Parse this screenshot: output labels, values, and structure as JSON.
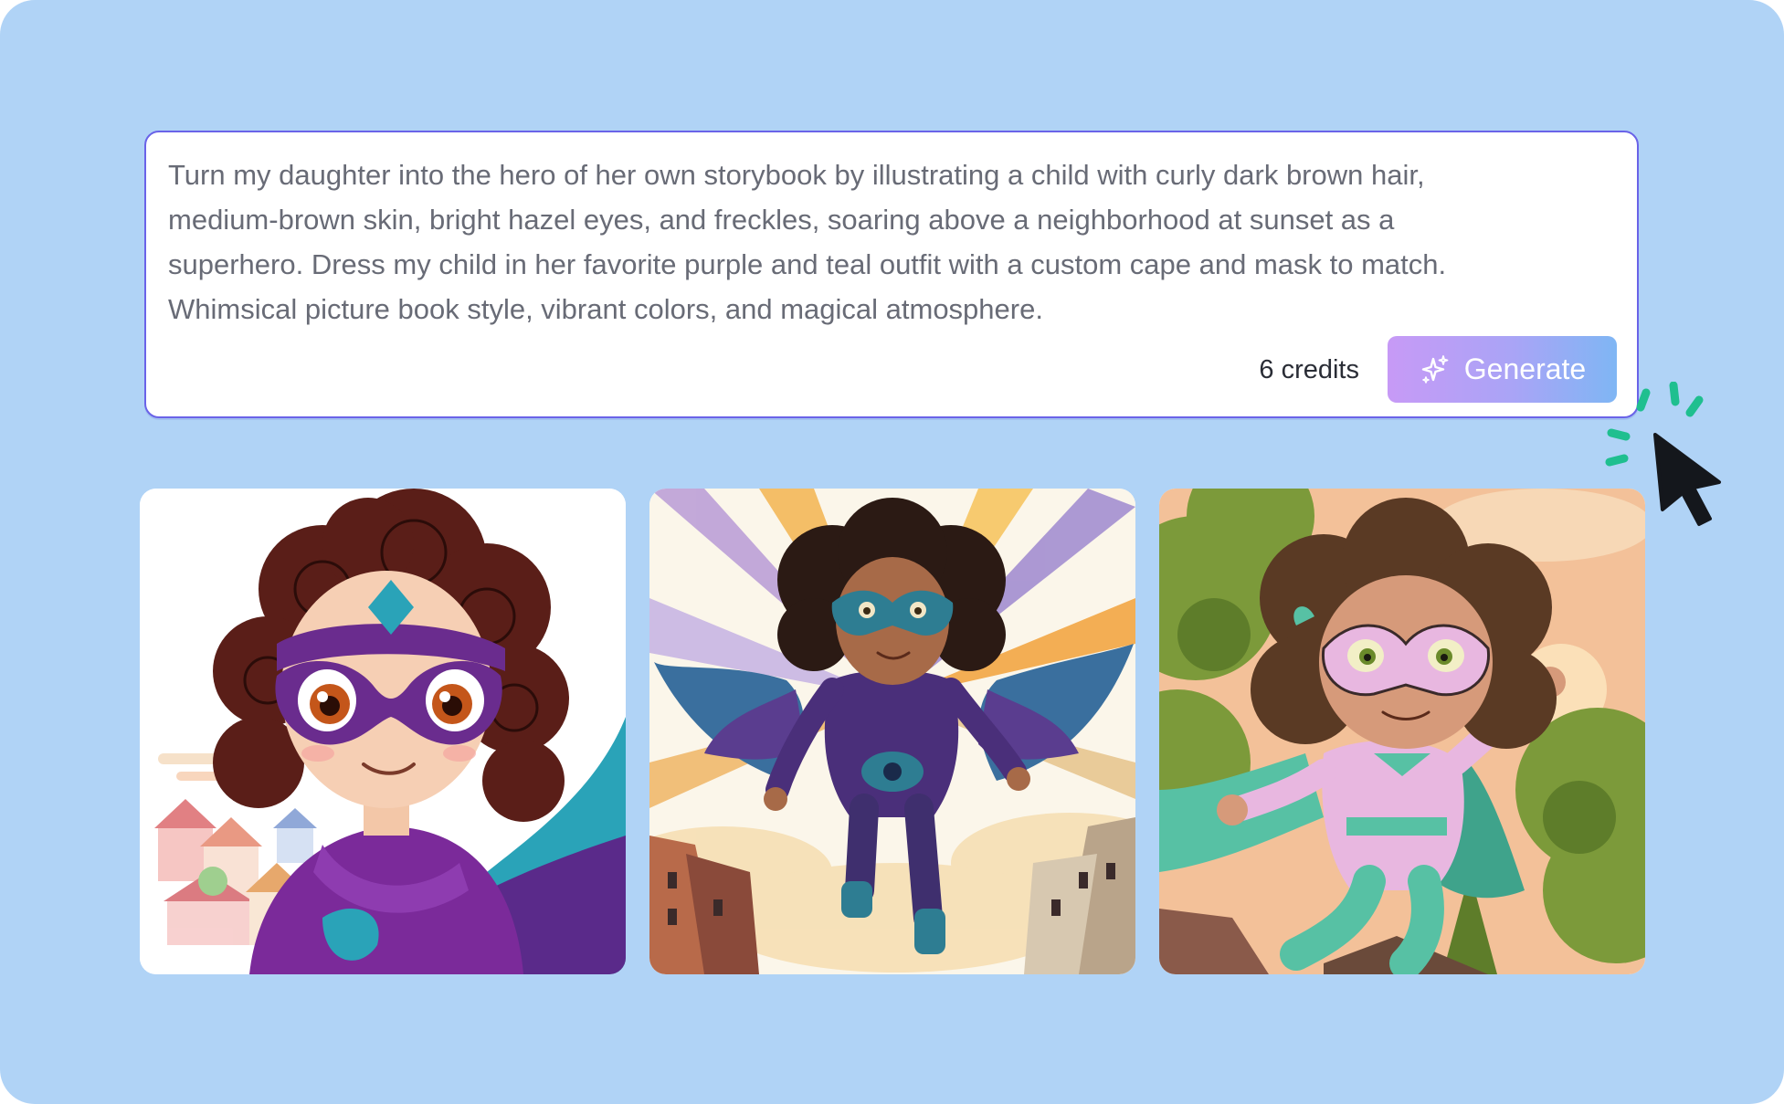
{
  "prompt": {
    "text": "Turn my daughter into the hero of her own storybook by illustrating a child with curly dark brown hair,\nmedium-brown skin, bright hazel eyes, and freckles, soaring above a neighborhood at sunset as a\nsuperhero. Dress my child in her favorite purple and teal outfit with a custom cape and mask to match.\nWhimsical picture book style, vibrant colors, and magical atmosphere."
  },
  "footer": {
    "credits_label": "6 credits",
    "generate_label": "Generate",
    "generate_icon": "sparkles-icon"
  },
  "cursor": {
    "icon": "mouse-pointer-icon",
    "effect_color": "#1fbf8f"
  },
  "colors": {
    "background": "#b0d3f6",
    "card_border": "#6a63e8",
    "button_gradient": [
      "#c79af6",
      "#7fb6f4"
    ],
    "prompt_text": "#686b76"
  },
  "results": [
    {
      "style": "anime-superhero-girl",
      "palette": [
        "#7b2a9a",
        "#2aa3b8",
        "#5a1e18"
      ]
    },
    {
      "style": "sketch-flying-superhero",
      "palette": [
        "#4a2f7a",
        "#2e7d92",
        "#f2a23a"
      ]
    },
    {
      "style": "storybook-superhero-girl",
      "palette": [
        "#e8b7e0",
        "#57c1a4",
        "#7c9a3a"
      ]
    }
  ]
}
